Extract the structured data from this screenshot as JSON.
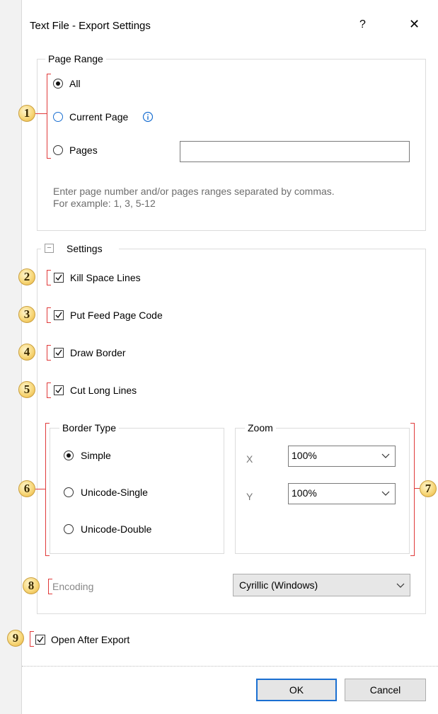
{
  "window": {
    "title": "Text File - Export Settings",
    "help_label": "?",
    "close_label": "✕"
  },
  "page_range": {
    "legend": "Page Range",
    "options": [
      "All",
      "Current Page",
      "Pages"
    ],
    "selected": "All",
    "pages_value": "",
    "hint_line1": "Enter page number and/or pages ranges separated by commas.",
    "hint_line2": "For example: 1, 3, 5-12"
  },
  "settings": {
    "legend": "Settings",
    "collapse_label": "−",
    "kill_space_lines": {
      "label": "Kill Space Lines",
      "checked": true
    },
    "put_feed_page_code": {
      "label": "Put Feed Page Code",
      "checked": true
    },
    "draw_border": {
      "label": "Draw Border",
      "checked": true
    },
    "cut_long_lines": {
      "label": "Cut Long Lines",
      "checked": true
    },
    "border_type": {
      "legend": "Border Type",
      "options": [
        "Simple",
        "Unicode-Single",
        "Unicode-Double"
      ],
      "selected": "Simple"
    },
    "zoom": {
      "legend": "Zoom",
      "x_label": "X",
      "y_label": "Y",
      "x_value": "100%",
      "y_value": "100%"
    },
    "encoding": {
      "label": "Encoding",
      "value": "Cyrillic (Windows)"
    }
  },
  "open_after_export": {
    "label": "Open After Export",
    "checked": true
  },
  "buttons": {
    "ok": "OK",
    "cancel": "Cancel"
  },
  "badges": [
    "1",
    "2",
    "3",
    "4",
    "5",
    "6",
    "7",
    "8",
    "9"
  ],
  "colors": {
    "annotation_red": "#e03a3a",
    "badge_gold": "#f7d77a",
    "ok_border": "#1a6fd1",
    "info_blue": "#1a6fd1"
  }
}
